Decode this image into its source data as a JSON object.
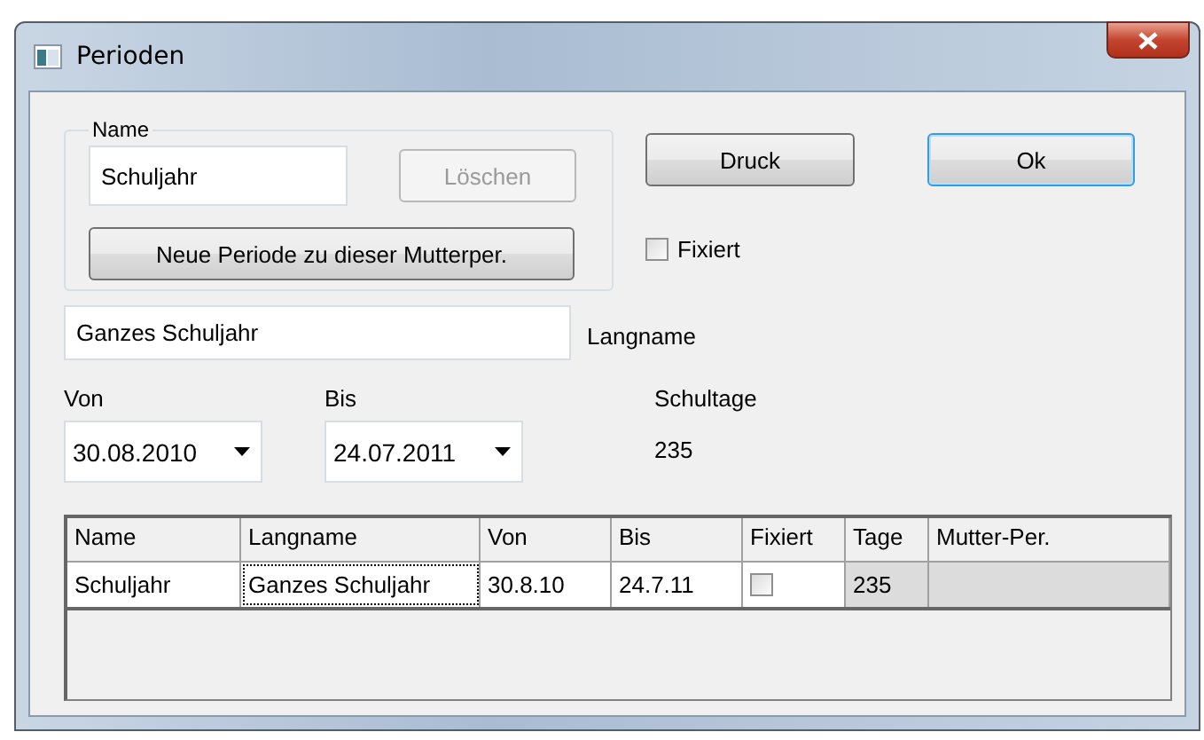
{
  "window": {
    "title": "Perioden"
  },
  "name_group": {
    "legend": "Name",
    "value": "Schuljahr",
    "delete_button": {
      "label": "Löschen",
      "disabled": true
    },
    "new_button": "Neue Periode zu dieser Mutterper."
  },
  "print_button": "Druck",
  "ok_button": "Ok",
  "fixed": {
    "label": "Fixiert",
    "checked": false
  },
  "longname": {
    "value": "Ganzes Schuljahr",
    "label": "Langname"
  },
  "from": {
    "label": "Von",
    "value": "30.08.2010"
  },
  "to": {
    "label": "Bis",
    "value": "24.07.2011"
  },
  "school_days": {
    "label": "Schultage",
    "value": "235"
  },
  "table": {
    "columns": [
      "Name",
      "Langname",
      "Von",
      "Bis",
      "Fixiert",
      "Tage",
      "Mutter-Per."
    ],
    "rows": [
      {
        "cells": [
          {
            "kind": "text",
            "text": "Schuljahr",
            "focused": false
          },
          {
            "kind": "text",
            "text": "Ganzes Schuljahr",
            "focused": true
          },
          {
            "kind": "text",
            "text": "30.8.10",
            "focused": false
          },
          {
            "kind": "text",
            "text": "24.7.11",
            "focused": false
          },
          {
            "kind": "check",
            "checked": false
          },
          {
            "kind": "readonly",
            "text": "235"
          },
          {
            "kind": "readonly"
          }
        ]
      }
    ]
  }
}
